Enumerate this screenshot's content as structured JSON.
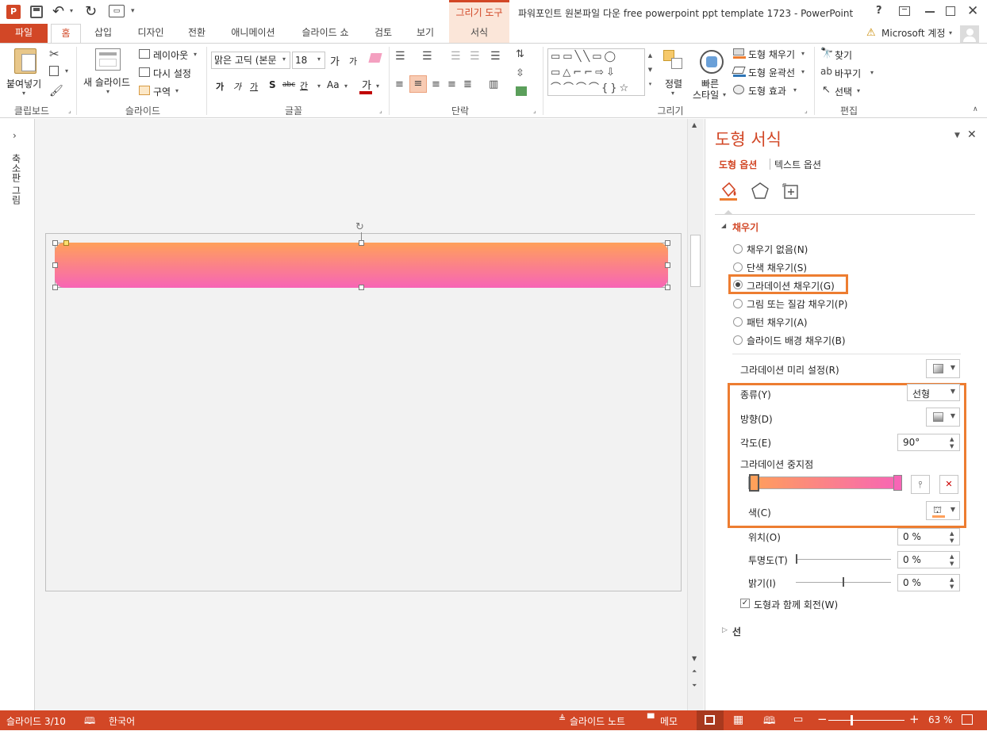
{
  "window": {
    "title": "파워포인트 원본파일 다운 free powerpoint ppt template 1723 - PowerPoint",
    "contextual_group": "그리기 도구",
    "help": "?",
    "account": "Microsoft 계정"
  },
  "tabs": [
    "파일",
    "홈",
    "삽입",
    "디자인",
    "전환",
    "애니메이션",
    "슬라이드 쇼",
    "검토",
    "보기",
    "서식"
  ],
  "active_tab": "홈",
  "ribbon": {
    "clipboard": {
      "paste": "붙여넣기",
      "label": "클립보드"
    },
    "slides": {
      "new_slide": "새 슬라이드",
      "layout": "레이아웃",
      "reset": "다시 설정",
      "section": "구역",
      "label": "슬라이드"
    },
    "font": {
      "font_name": "맑은 고딕 (본문",
      "font_size": "18",
      "grow": "가",
      "shrink": "가",
      "bold": "가",
      "italic": "가",
      "underline": "가",
      "shadow": "S",
      "strike": "abc",
      "spacing": "간",
      "case": "Aa",
      "color": "가",
      "label": "글꼴"
    },
    "paragraph": {
      "label": "단락"
    },
    "drawing": {
      "arrange": "정렬",
      "quick_styles_1": "빠른",
      "quick_styles_2": "스타일",
      "shape_fill": "도형 채우기",
      "shape_outline": "도형 윤곽선",
      "shape_effects": "도형 효과",
      "label": "그리기"
    },
    "editing": {
      "find": "찾기",
      "replace": "바꾸기",
      "select": "선택",
      "label": "편집"
    }
  },
  "left_panel": {
    "label": "축소판 그림"
  },
  "pane": {
    "title": "도형 서식",
    "tab_shape": "도형 옵션",
    "tab_text": "텍스트 옵션",
    "fill_section": "채우기",
    "fill_options": [
      "채우기 없음(N)",
      "단색 채우기(S)",
      "그라데이션 채우기(G)",
      "그림 또는 질감 채우기(P)",
      "패턴 채우기(A)",
      "슬라이드 배경 채우기(B)"
    ],
    "selected_fill": 2,
    "preset_label": "그라데이션 미리 설정(R)",
    "type_label": "종류(Y)",
    "type_value": "선형",
    "direction_label": "방향(D)",
    "angle_label": "각도(E)",
    "angle_value": "90°",
    "stops_label": "그라데이션 중지점",
    "color_label": "색(C)",
    "position_label": "위치(O)",
    "position_value": "0 %",
    "transparency_label": "투명도(T)",
    "transparency_value": "0 %",
    "brightness_label": "밝기(I)",
    "brightness_value": "0 %",
    "rotate_label": "도형과 함께 회전(W)",
    "rotate_checked": true,
    "line_section": "선"
  },
  "status": {
    "slide": "슬라이드 3/10",
    "language": "한국어",
    "notes": "슬라이드 노트",
    "comments": "메모",
    "zoom": "63 %"
  },
  "colors": {
    "accent": "#d24726",
    "highlight_box": "#ed7d31",
    "gradient_top": "#ffa05a",
    "gradient_bottom": "#f765b6"
  }
}
